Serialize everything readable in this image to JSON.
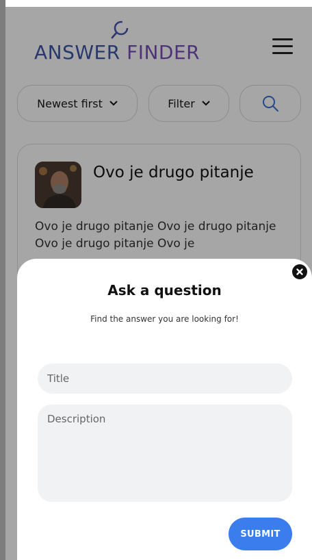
{
  "header": {
    "logo_word1": "ANSWER",
    "logo_word2": "FINDER",
    "logo_icon": "magnifier-icon",
    "menu_icon": "hamburger-icon"
  },
  "toolbar": {
    "sort_label": "Newest first",
    "filter_label": "Filter",
    "search_icon": "search-icon"
  },
  "question": {
    "title": "Ovo je drugo pitanje",
    "body": "Ovo je drugo pitanje Ovo je drugo pitanje Ovo je drugo pitanje Ovo je"
  },
  "modal": {
    "title": "Ask a question",
    "subtitle": "Find the answer you are looking for!",
    "title_placeholder": "Title",
    "description_placeholder": "Description",
    "submit_label": "SUBMIT",
    "close_icon": "close-icon"
  },
  "colors": {
    "brand_blue": "#3e57a8",
    "brand_purple": "#7a4fb8",
    "primary_button": "#3b7ded",
    "field_background": "#f1f2f4"
  }
}
